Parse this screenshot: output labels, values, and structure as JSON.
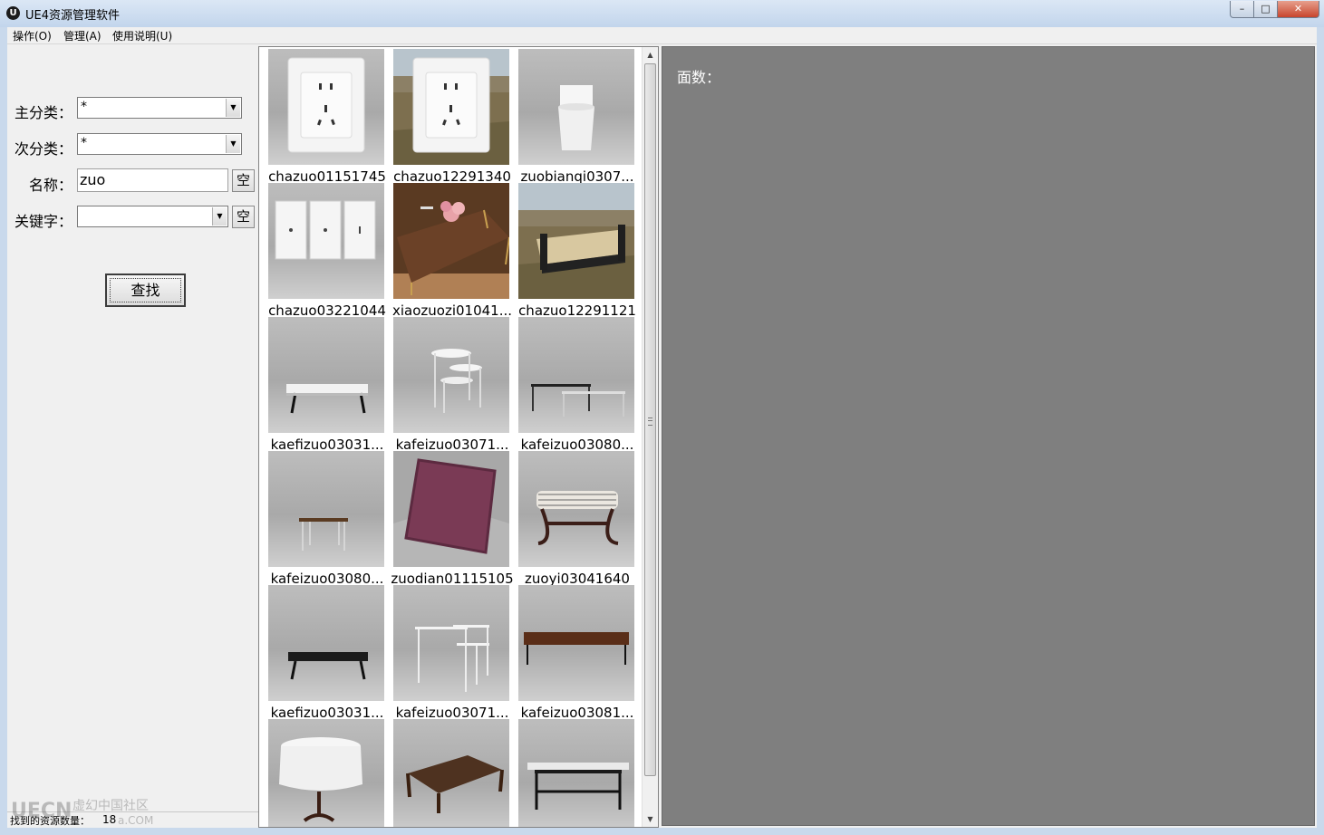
{
  "window": {
    "icon_glyph": "U",
    "title": "UE4资源管理软件",
    "buttons": [
      "minimize-icon",
      "maximize-icon",
      "close-icon"
    ]
  },
  "menu": {
    "items": [
      "操作(O)",
      "管理(A)",
      "使用说明(U)"
    ]
  },
  "filters": {
    "main_category_label": "主分类：",
    "main_category_value": "*",
    "sub_category_label": "次分类：",
    "sub_category_value": "*",
    "name_label": "名称：",
    "name_value": "zuo",
    "clear_label": "空",
    "keyword_label": "关键字：",
    "keyword_value": "",
    "search_button": "查找"
  },
  "status": {
    "found_label": "找到的资源数量：",
    "found_count": "18"
  },
  "thumbnails": [
    {
      "name": "chazuo01151745",
      "kind": "socket",
      "bg": "studio"
    },
    {
      "name": "chazuo12291340",
      "kind": "socket",
      "bg": "field"
    },
    {
      "name": "zuobianqi0307...",
      "kind": "toilet",
      "bg": "studio"
    },
    {
      "name": "chazuo03221044",
      "kind": "socket3",
      "bg": "studio"
    },
    {
      "name": "xiaozuozi01041...",
      "kind": "woodtable",
      "bg": "wood"
    },
    {
      "name": "chazuo12291121",
      "kind": "daybed",
      "bg": "field"
    },
    {
      "name": "kaefizuo03031...",
      "kind": "whitebench",
      "bg": "studio"
    },
    {
      "name": "kafeizuo03071...",
      "kind": "nesttables",
      "bg": "studio"
    },
    {
      "name": "kafeizuo03080...",
      "kind": "nesting",
      "bg": "studio"
    },
    {
      "name": "kafeizuo03080...",
      "kind": "smalltable",
      "bg": "studio"
    },
    {
      "name": "zuodian01115105",
      "kind": "cushion",
      "bg": "checker"
    },
    {
      "name": "zuoyi03041640",
      "kind": "ottoman",
      "bg": "studio"
    },
    {
      "name": "kaefizuo03031...",
      "kind": "darkbench",
      "bg": "studio"
    },
    {
      "name": "kafeizuo03071...",
      "kind": "nesting2",
      "bg": "studio"
    },
    {
      "name": "kafeizuo03081...",
      "kind": "console",
      "bg": "studio"
    },
    {
      "name": "",
      "kind": "roundtable",
      "bg": "studio"
    },
    {
      "name": "",
      "kind": "carvedtable",
      "bg": "studio"
    },
    {
      "name": "",
      "kind": "desk",
      "bg": "studio"
    }
  ],
  "viewer": {
    "face_count_label": "面数："
  },
  "watermark": {
    "text": "UECN 虚幻中国社区 .COM"
  }
}
